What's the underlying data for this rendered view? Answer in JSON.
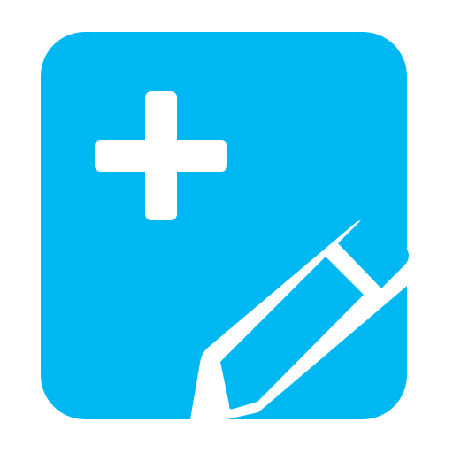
{
  "icon": {
    "name": "add-note-edit-icon",
    "colors": {
      "background": "#ffffff",
      "tile": "#00b8f1",
      "glyph": "#ffffff"
    },
    "parts": [
      "square-tile",
      "plus-sign",
      "pencil"
    ]
  }
}
